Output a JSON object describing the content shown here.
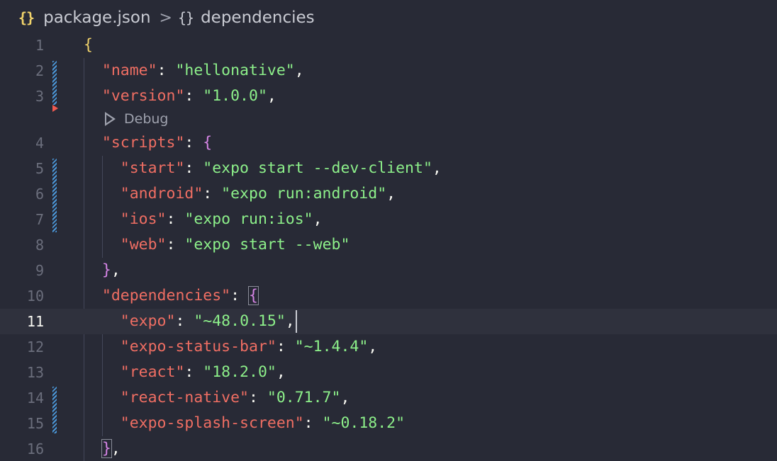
{
  "breadcrumb": {
    "icon": "{}",
    "file": "package.json",
    "separator": ">",
    "symbol_icon": "{}",
    "symbol": "dependencies"
  },
  "codelens": {
    "label": "Debug"
  },
  "lines": [
    {
      "n": "1"
    },
    {
      "n": "2",
      "key": "\"name\"",
      "value": "\"hellonative\""
    },
    {
      "n": "3",
      "key": "\"version\"",
      "value": "\"1.0.0\""
    },
    {
      "n": "4",
      "key": "\"scripts\""
    },
    {
      "n": "5",
      "key": "\"start\"",
      "value": "\"expo start --dev-client\""
    },
    {
      "n": "6",
      "key": "\"android\"",
      "value": "\"expo run:android\""
    },
    {
      "n": "7",
      "key": "\"ios\"",
      "value": "\"expo run:ios\""
    },
    {
      "n": "8",
      "key": "\"web\"",
      "value": "\"expo start --web\""
    },
    {
      "n": "9"
    },
    {
      "n": "10",
      "key": "\"dependencies\""
    },
    {
      "n": "11",
      "key": "\"expo\"",
      "value": "\"~48.0.15\""
    },
    {
      "n": "12",
      "key": "\"expo-status-bar\"",
      "value": "\"~1.4.4\""
    },
    {
      "n": "13",
      "key": "\"react\"",
      "value": "\"18.2.0\""
    },
    {
      "n": "14",
      "key": "\"react-native\"",
      "value": "\"0.71.7\""
    },
    {
      "n": "15",
      "key": "\"expo-splash-screen\"",
      "value": "\"~0.18.2\""
    },
    {
      "n": "16"
    }
  ],
  "colors": {
    "background": "#282a36",
    "key": "#ef6e63",
    "string": "#8df08a",
    "brace_outer": "#f1d36b",
    "brace_inner": "#d685e6",
    "modified_marker": "#4b97d9"
  }
}
